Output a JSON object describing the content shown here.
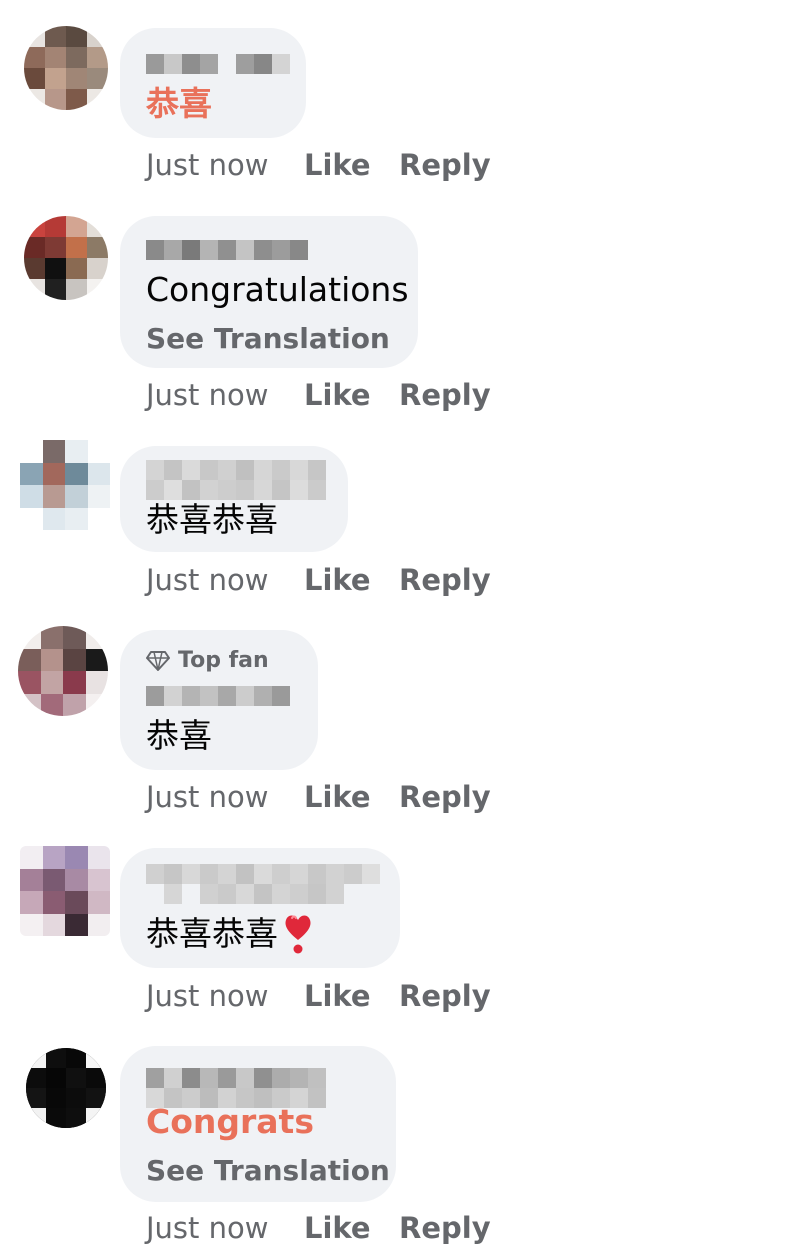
{
  "comments": [
    {
      "text": "恭喜",
      "time": "Just now",
      "like": "Like",
      "reply": "Reply"
    },
    {
      "text": "Congratulations",
      "see_translation": "See Translation",
      "time": "Just now",
      "like": "Like",
      "reply": "Reply"
    },
    {
      "text": "恭喜恭喜",
      "time": "Just now",
      "like": "Like",
      "reply": "Reply"
    },
    {
      "badge": "Top fan",
      "text": "恭喜",
      "time": "Just now",
      "like": "Like",
      "reply": "Reply"
    },
    {
      "text": "恭喜恭喜",
      "emoji_icon": "heart-exclamation-icon",
      "time": "Just now",
      "like": "Like",
      "reply": "Reply"
    },
    {
      "text": "Congrats",
      "see_translation": "See Translation",
      "time": "Just now",
      "like": "Like",
      "reply": "Reply"
    }
  ],
  "colors": {
    "bubble": "#f0f2f5",
    "highlight": "#e9715a",
    "secondary": "#65676b",
    "text": "#050505"
  }
}
